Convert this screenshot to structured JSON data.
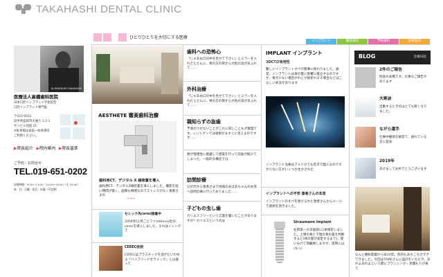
{
  "logo": {
    "text": "TAKAHASHI DENTAL CLINIC"
  },
  "tagline": "ひとりひとりを大切にする医療",
  "top_tabs": [
    {
      "label": "インプラント",
      "color": "#58b7e0"
    },
    {
      "label": "審美歯科",
      "color": "#8dc63f"
    },
    {
      "label": "予防歯科",
      "color": "#e36fa8"
    },
    {
      "label": "診療案内",
      "color": "#f4a93b"
    }
  ],
  "profile": {
    "doctor_caption": "Dr.HIDENORI TAKAHASHI",
    "clinic_name": "医療法人高橋歯科医院",
    "affiliation1": "日本口腔インプラント学会認定",
    "affiliation2": "口腔インプラント専門医",
    "postal": "〒020-0022",
    "address": "岩手県盛岡市大通り 1-2-1",
    "building": "サンビル別館 2F",
    "parking": "※駐車場は会館一駐車場を",
    "parking2": "ご利用ください。",
    "links": [
      "院長紹介",
      "院内案内",
      "院長基準"
    ],
    "contact_label": "ご予約・お問合せ",
    "phone": "TEL.019-651-0202",
    "hours": "診療時間：9:30〜13:00／14:30〜18:00（土 16:00）",
    "closed": "休　日：日曜・祝日・木曜（不定期）"
  },
  "aesthete": {
    "title": "AESTHETE 審美歯科治療",
    "sub": "歯科用CT、デジタル X 線装置を導入",
    "body": "歯科用CT、デジタルX線装置を導入しました。撮影を短い時間が無く、画像も鮮明なのでストレスがなく患者さまの",
    "more": "→→→",
    "items": [
      {
        "title": "セレック先cerec随着中",
        "body": "2009年11月ごとファ(ethena)社のcerecを導入しました。それはイニングで"
      },
      {
        "title": "CEREC症例",
        "body": "CERECはプラスチックを混ぜたいわゆる「ハイブリッドセラミック」とは違って"
      }
    ]
  },
  "col3": {
    "sections": [
      {
        "title": "歯科への恐怖心",
        "body": "「じゃあお口の中を見せて下さい」とミラーを入れたとたんに、胃の方の目から大粒の涙があふれて……"
      },
      {
        "title": "外科治療",
        "body": "「じゃあお口の中を見せて下さい」とミラーを入れたとたんに、胃の方の目から大粒の涙があふれて……"
      },
      {
        "title": "親知らずの抜歯",
        "body": "予測のつかないことがこれに同じこともが無理です。レントゲンでは歯根がますぐに見えるのですが……"
      },
      {
        "title": "",
        "body": "親が管相性に配慮して建築を行って前歯が抜けてしまった。一般的な構造では"
      },
      {
        "title": "訪問診療",
        "body": "父の代から患者さまで地域のおばあちゃんのお宅へ訪問診療に行っておりました……"
      },
      {
        "title": "子どもの虫し歯",
        "body": "カリエスフリーという言葉を聞いたことがありますか？カリエスというのは"
      }
    ]
  },
  "implant": {
    "title": "IMPLANT インプラント",
    "sub": "3DCTの有用性",
    "body": "難しいインプラントオペが無事に終わりました。通常、インプラントは骨の量に影響に確立するのですが、骨が少ない場合がわとせ組折れそそ場合などはこなしい状況があります",
    "mid": "インプラント治療はアメリカでも年次で国人なのですが少ない方がいくつか生かされた",
    "item2_title": "インプラントへの不安 患者さんの本音",
    "item2_body": "インプラントのオペを受けられた患者さんからメールで感想を頂きました。",
    "straumann_title": "Straumann Implant",
    "straumann_body": "左目第一大日歯部に1本確定しました。上顎の骨と下顎の骨の量を判断すると(骨の量が安定するまで)、使い分けて頂戴致しますが、実際には(なっ)"
  },
  "blog": {
    "title": "BLOG",
    "sub": "診療日誌",
    "entries": [
      {
        "title": "2件のご報告",
        "body": "院長の高橋です。大事なご報告があります"
      },
      {
        "title": "大寒波",
        "body": "出勤するときのはとても寒くなりました。"
      },
      {
        "title": "ながら運手",
        "body": "仕事中腰病を解定て、疲れている方に是非"
      },
      {
        "title": "2019年",
        "body": "あけましておめでとうございます"
      }
    ],
    "footer": "なんと腰私開業から早20年。院内もあちこちガタきてきました。今回はTAMEさんに設計をいただき、あれよあれよという間にプランニング・見積もりが来て"
  }
}
